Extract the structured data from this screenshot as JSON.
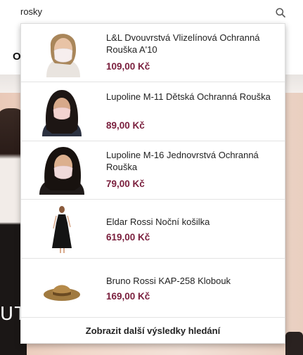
{
  "background": {
    "nav_letter": "O",
    "banner_text": "UTE"
  },
  "search": {
    "query": "rosky",
    "icon": "search-icon"
  },
  "results": [
    {
      "name": "L&L Dvouvrstvá Vlizelínová Ochranná Rouška A'10",
      "price": "109,00 Kč",
      "image": "face-mask-woman-photo"
    },
    {
      "name": "Lupoline M-11 Dětská Ochranná Rouška",
      "price": "89,00 Kč",
      "image": "child-face-mask-photo"
    },
    {
      "name": "Lupoline M-16 Jednovrstvá Ochranná Rouška",
      "price": "79,00 Kč",
      "image": "face-mask-woman-photo"
    },
    {
      "name": "Eldar Rossi Noční košilka",
      "price": "619,00 Kč",
      "image": "nightgown-photo"
    },
    {
      "name": "Bruno Rossi KAP-258 Klobouk",
      "price": "169,00 Kč",
      "image": "hat-photo"
    }
  ],
  "more_results_label": "Zobrazit další výsledky hledání",
  "colors": {
    "price": "#7a1f3d",
    "divider": "#e3e3e3"
  }
}
